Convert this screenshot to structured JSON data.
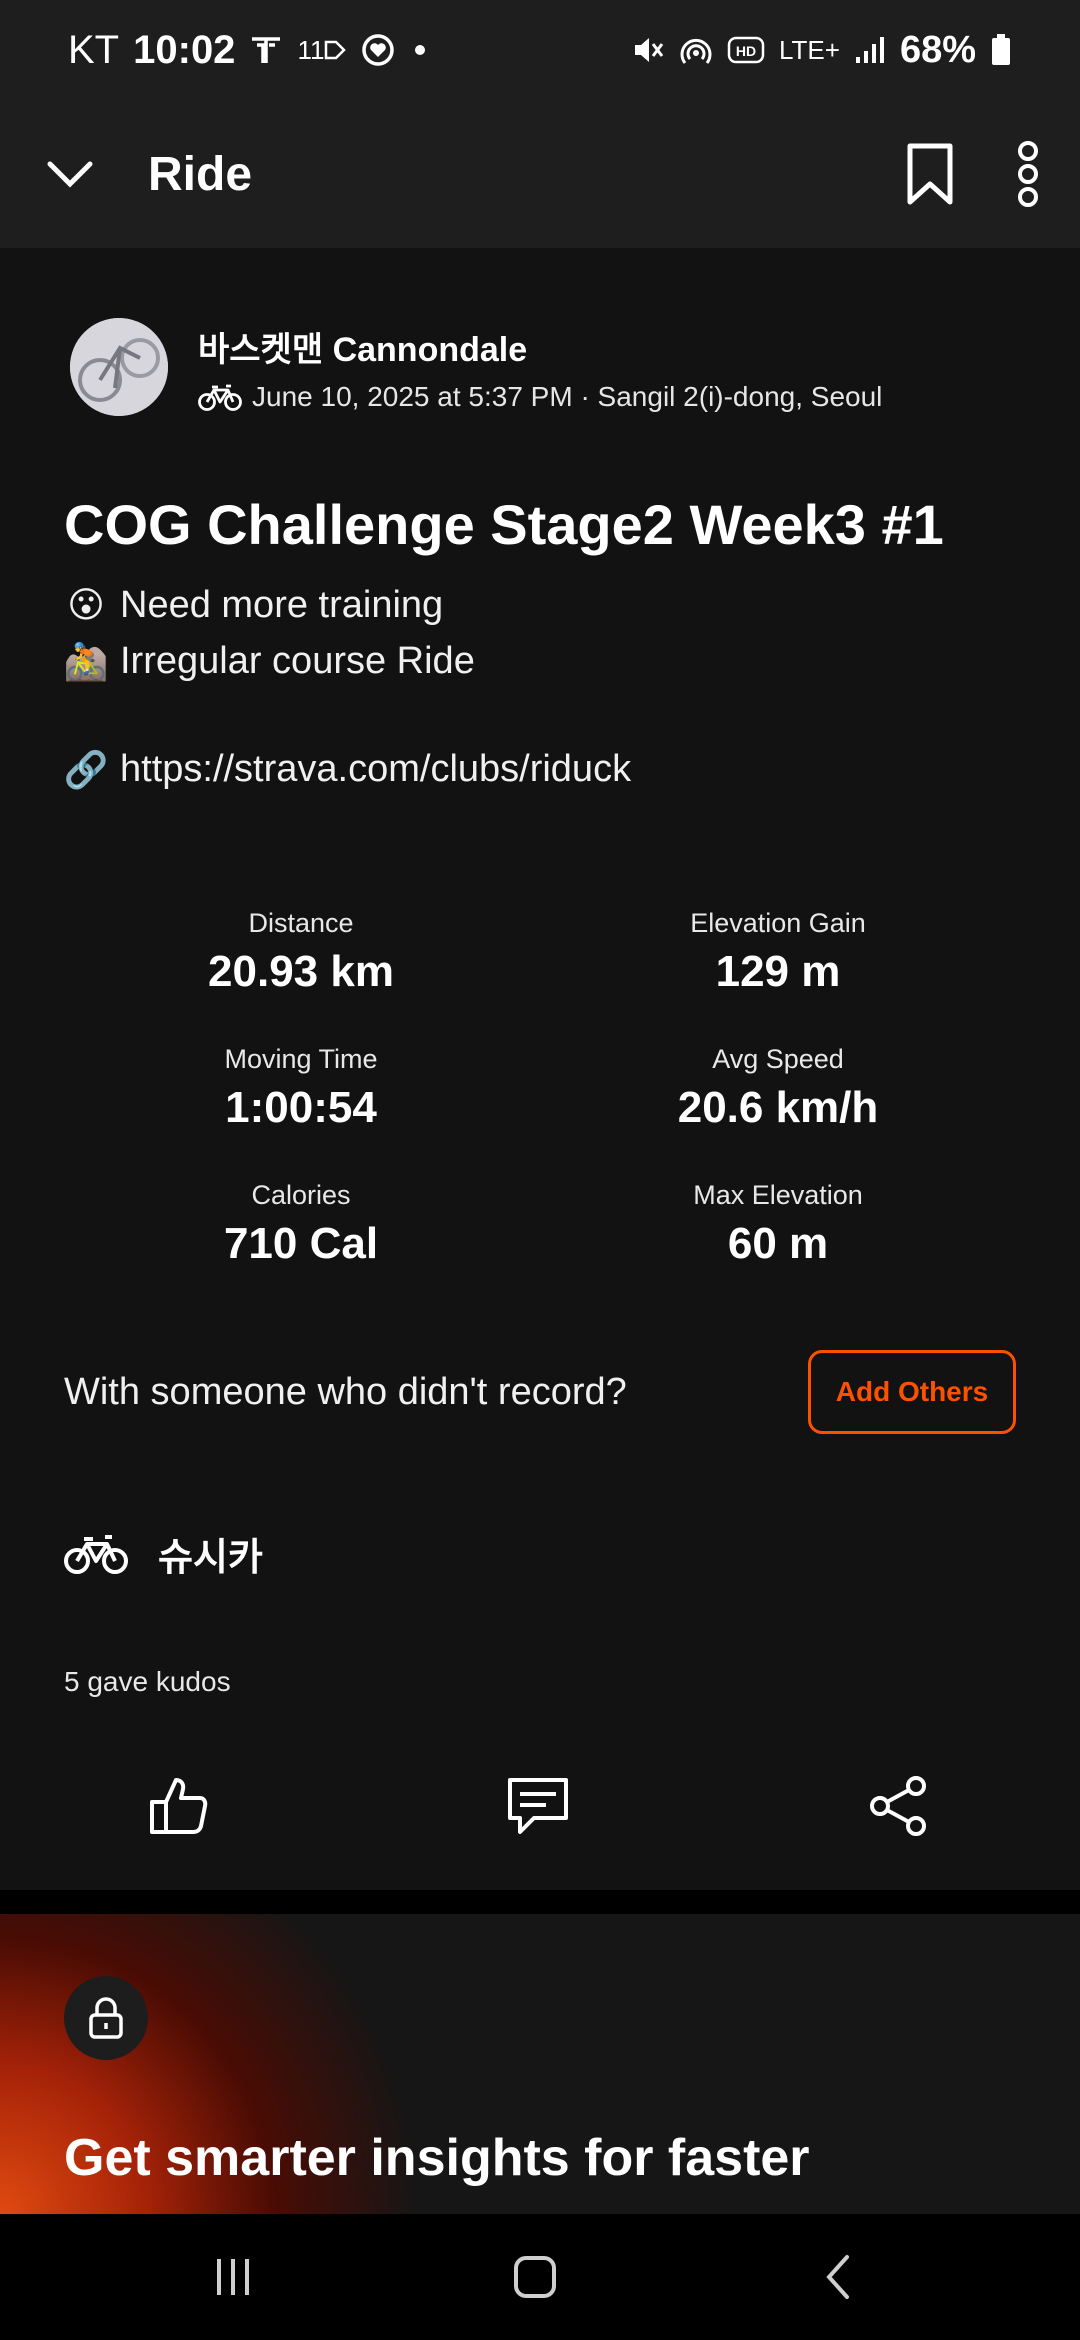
{
  "status_bar": {
    "carrier": "KT",
    "time": "10:02",
    "icons_left": [
      "t-icon",
      "11-arrow-icon",
      "heart-sync-icon",
      "dot-icon"
    ],
    "icons_right": [
      "mute-icon",
      "hotspot-icon",
      "hd-icon",
      "lte-plus-icon",
      "signal-icon",
      "battery-icon"
    ],
    "hd": "HD",
    "lte": "LTE+",
    "eleven": "11",
    "battery_percent": "68%"
  },
  "app_bar": {
    "title": "Ride",
    "back_icon": "chevron-down-icon",
    "bookmark_icon": "bookmark-icon",
    "more_icon": "more-vertical-icon"
  },
  "author": {
    "name": "바스켓맨 Cannondale",
    "date": "June 10, 2025 at 5:37 PM · Sangil 2(i)-dong, Seoul",
    "activity_icon": "bike-icon"
  },
  "activity": {
    "title": "COG Challenge Stage2 Week3 #1",
    "description": [
      {
        "emoji": "😮",
        "text": "Need more training"
      },
      {
        "emoji": "🚵",
        "text": "Irregular course Ride"
      },
      {
        "emoji": "🔗",
        "text": "https://strava.com/clubs/riduck"
      }
    ]
  },
  "stats": [
    {
      "label": "Distance",
      "value": "20.93 km"
    },
    {
      "label": "Elevation Gain",
      "value": "129 m"
    },
    {
      "label": "Moving Time",
      "value": "1:00:54"
    },
    {
      "label": "Avg Speed",
      "value": "20.6 km/h"
    },
    {
      "label": "Calories",
      "value": "710 Cal"
    },
    {
      "label": "Max Elevation",
      "value": "60 m"
    }
  ],
  "with_others": {
    "text": "With someone who didn't record?",
    "button": "Add Others"
  },
  "gear": {
    "name": "슈시카",
    "icon": "bike-icon"
  },
  "kudos": {
    "text": "5 gave kudos"
  },
  "actions": {
    "kudos_icon": "thumbs-up-icon",
    "comment_icon": "comment-icon",
    "share_icon": "share-icon"
  },
  "promo": {
    "title": "Get smarter insights for faster",
    "icon": "lock-icon"
  },
  "nav_bar": {
    "recents_icon": "recents-icon",
    "home_icon": "home-icon",
    "back_icon": "back-icon"
  },
  "colors": {
    "accent": "#fc5200",
    "background": "#121212",
    "app_bar": "#1e1e1e"
  }
}
